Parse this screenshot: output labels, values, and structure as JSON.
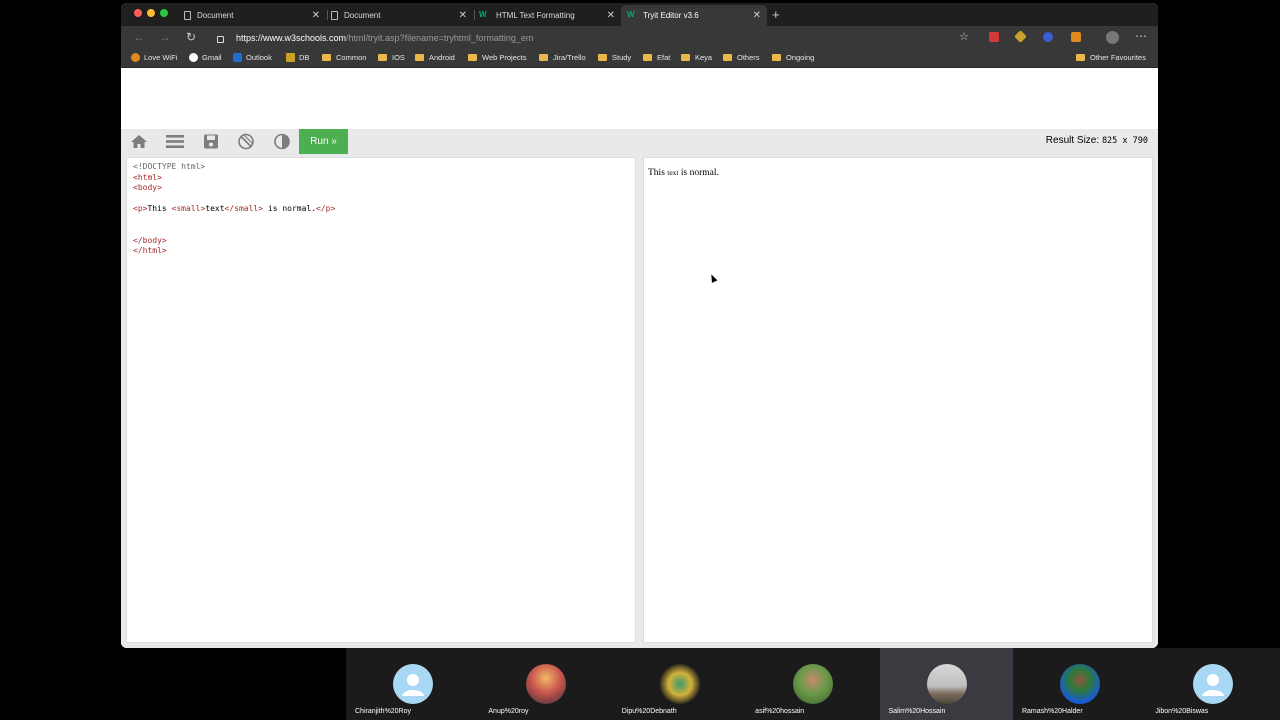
{
  "browser": {
    "tabs": [
      {
        "title": "Document",
        "icon": "document-icon",
        "active": false
      },
      {
        "title": "Document",
        "icon": "document-icon",
        "active": false
      },
      {
        "title": "HTML Text Formatting",
        "icon": "w3schools-icon",
        "active": false
      },
      {
        "title": "Tryit Editor v3.6",
        "icon": "w3schools-icon",
        "active": true
      }
    ],
    "url_host": "https://www.w3schools.com",
    "url_path": "/html/tryit.asp?filename=tryhtml_formatting_em",
    "bookmarks": [
      {
        "label": "Love WiFi",
        "type": "site"
      },
      {
        "label": "Gmail",
        "type": "site"
      },
      {
        "label": "Outlook",
        "type": "site"
      },
      {
        "label": "DB",
        "type": "site"
      },
      {
        "label": "Common",
        "type": "folder"
      },
      {
        "label": "IOS",
        "type": "folder"
      },
      {
        "label": "Android",
        "type": "folder"
      },
      {
        "label": "Web Projects",
        "type": "folder"
      },
      {
        "label": "Jira/Trello",
        "type": "folder"
      },
      {
        "label": "Study",
        "type": "folder"
      },
      {
        "label": "Efat",
        "type": "folder"
      },
      {
        "label": "Keya",
        "type": "folder"
      },
      {
        "label": "Others",
        "type": "folder"
      },
      {
        "label": "Ongoing",
        "type": "folder"
      }
    ],
    "other_bookmarks": "Other Favourites"
  },
  "tryit": {
    "run_label": "Run »",
    "result_size_label": "Result Size:",
    "result_size_value": "825 x 790",
    "code_lines": [
      "<!DOCTYPE html>",
      "<html>",
      "<body>",
      "",
      "<p>This <small>text</small> is normal.</p>",
      "",
      "",
      "</body>",
      "</html>"
    ],
    "result": {
      "before": "This ",
      "small": "text",
      "after": " is normal."
    }
  },
  "participants": [
    {
      "name": "Chiranjith%20Roy",
      "avatar": "default-user"
    },
    {
      "name": "Anup%20roy",
      "avatar": "photo"
    },
    {
      "name": "Dipu%20Debnath",
      "avatar": "photo"
    },
    {
      "name": "asif%20hossain",
      "avatar": "photo"
    },
    {
      "name": "Salim%20Hossain",
      "avatar": "photo",
      "speaking": true
    },
    {
      "name": "Ramash%20Halder",
      "avatar": "photo"
    },
    {
      "name": "Jibon%20Biswas",
      "avatar": "default-user"
    }
  ],
  "colors": {
    "run_button": "#4caf50",
    "toolbar_bg": "#e7e9eb",
    "bookmark_folder": "#e8b84b",
    "browser_chrome": "#383838"
  }
}
